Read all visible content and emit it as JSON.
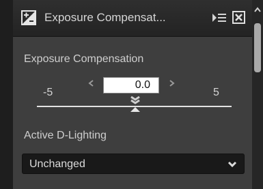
{
  "panel": {
    "title": "Exposure Compensat...",
    "icons": {
      "title_icon": "exposure-compensation-icon",
      "menu_icon": "panel-menu-icon",
      "close_icon": "close-icon"
    }
  },
  "exposure": {
    "label": "Exposure Compensation",
    "min_label": "-5",
    "max_label": "5",
    "value": "0.0",
    "slider": {
      "min": -5,
      "max": 5,
      "value": 0.0
    }
  },
  "dlighting": {
    "label": "Active D-Lighting",
    "selected": "Unchanged"
  },
  "colors": {
    "panel_bg": "#3e3e3e",
    "titlebar_bg": "#2a2a2a",
    "text": "#d6d6d6",
    "scroll_thumb": "#a9a9a9"
  }
}
